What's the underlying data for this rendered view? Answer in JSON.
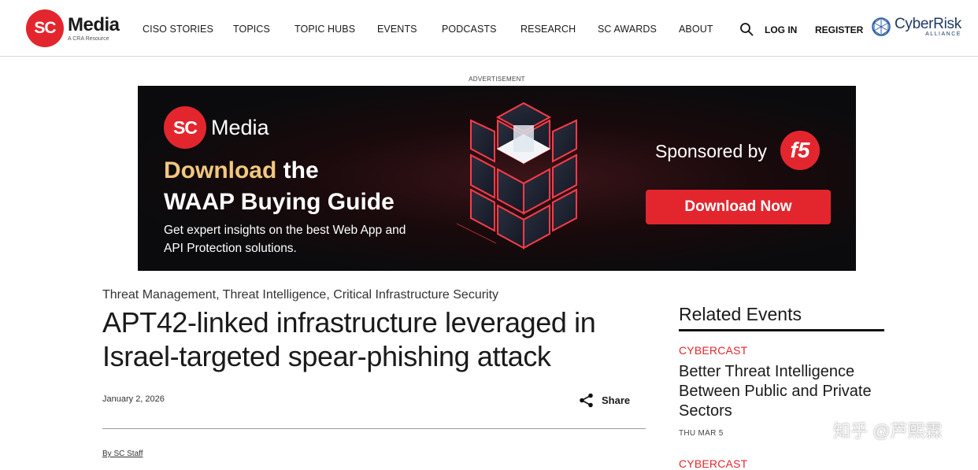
{
  "header": {
    "logo_mark": "SC",
    "logo_name": "Media",
    "logo_sub": "A CRA Resource",
    "nav": [
      "CISO STORIES",
      "TOPICS",
      "TOPIC HUBS",
      "EVENTS",
      "PODCASTS",
      "RESEARCH",
      "SC AWARDS",
      "ABOUT"
    ],
    "login": "LOG IN",
    "register": "REGISTER",
    "partner_name": "CyberRisk",
    "partner_sub": "ALLIANCE"
  },
  "ad": {
    "label": "ADVERTISEMENT",
    "logo_mark": "SC",
    "logo_name": "Media",
    "headline_highlight": "Download",
    "headline_rest_1": "the",
    "headline_line2": "WAAP Buying Guide",
    "description": "Get expert insights on the best Web App and API Protection solutions.",
    "sponsored_by": "Sponsored by",
    "sponsor_logo": "f5",
    "cta": "Download Now"
  },
  "article": {
    "categories": "Threat Management, Threat Intelligence, Critical Infrastructure Security",
    "title": "APT42-linked infrastructure leveraged in Israel-targeted spear-phishing attack",
    "date": "January 2, 2026",
    "share": "Share",
    "byline": "By SC Staff"
  },
  "sidebar": {
    "title": "Related Events",
    "events": [
      {
        "type": "CYBERCAST",
        "title": "Better Threat Intelligence Between Public and Private Sectors",
        "date": "THU MAR 5"
      },
      {
        "type": "CYBERCAST"
      }
    ]
  },
  "watermark": "知乎 @芦熙霖",
  "colors": {
    "brand_red": "#e3262e",
    "ad_gold": "#f2c77e",
    "partner_blue": "#1f3a66"
  }
}
